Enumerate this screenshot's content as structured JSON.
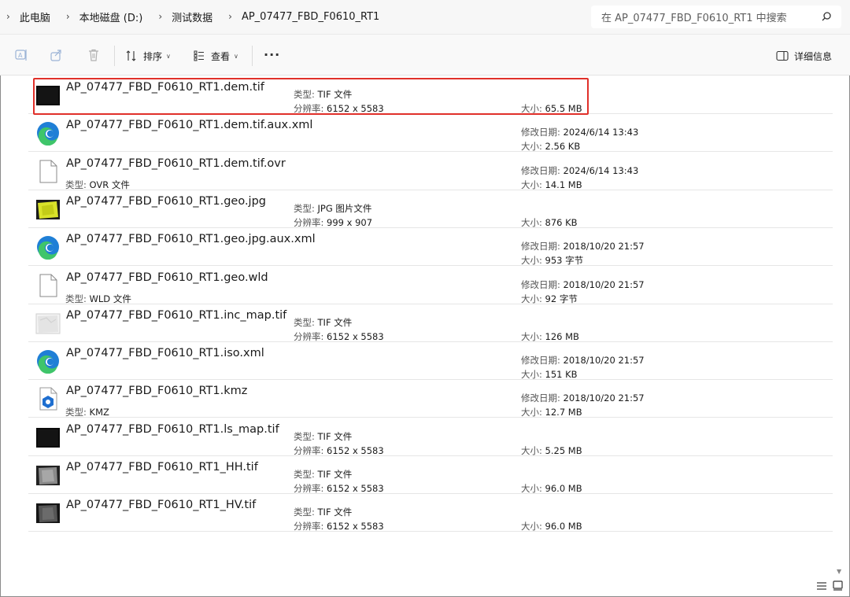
{
  "address": {
    "crumbs": [
      "此电脑",
      "本地磁盘 (D:)",
      "测试数据",
      "AP_07477_FBD_F0610_RT1"
    ],
    "search_placeholder": "在 AP_07477_FBD_F0610_RT1 中搜索"
  },
  "toolbar": {
    "sort_label": "排序",
    "view_label": "查看",
    "more_label": "···",
    "details_label": "详细信息"
  },
  "labels": {
    "type": "类型:",
    "resolution": "分辨率:",
    "size": "大小:",
    "modified": "修改日期:"
  },
  "files": [
    {
      "name": "AP_07477_FBD_F0610_RT1.dem.tif",
      "icon": "dark-image-thumbnail",
      "type": "TIF 文件",
      "resolution": "6152 x 5583",
      "size": "65.5 MB",
      "highlighted": true
    },
    {
      "name": "AP_07477_FBD_F0610_RT1.dem.tif.aux.xml",
      "icon": "edge-icon",
      "modified": "2024/6/14 13:43",
      "size": "2.56 KB"
    },
    {
      "name": "AP_07477_FBD_F0610_RT1.dem.tif.ovr",
      "icon": "blank-file-icon",
      "type": "OVR 文件",
      "modified": "2024/6/14 13:43",
      "size": "14.1 MB"
    },
    {
      "name": "AP_07477_FBD_F0610_RT1.geo.jpg",
      "icon": "yellow-image-thumbnail",
      "type": "JPG 图片文件",
      "resolution": "999 x 907",
      "size": "876 KB"
    },
    {
      "name": "AP_07477_FBD_F0610_RT1.geo.jpg.aux.xml",
      "icon": "edge-icon",
      "modified": "2018/10/20 21:57",
      "size": "953 字节"
    },
    {
      "name": "AP_07477_FBD_F0610_RT1.geo.wld",
      "icon": "blank-file-icon",
      "type": "WLD 文件",
      "modified": "2018/10/20 21:57",
      "size": "92 字节"
    },
    {
      "name": "AP_07477_FBD_F0610_RT1.inc_map.tif",
      "icon": "light-image-thumbnail",
      "type": "TIF 文件",
      "resolution": "6152 x 5583",
      "size": "126 MB"
    },
    {
      "name": "AP_07477_FBD_F0610_RT1.iso.xml",
      "icon": "edge-icon",
      "modified": "2018/10/20 21:57",
      "size": "151 KB"
    },
    {
      "name": "AP_07477_FBD_F0610_RT1.kmz",
      "icon": "kmz-file-icon",
      "type": "KMZ",
      "modified": "2018/10/20 21:57",
      "size": "12.7 MB"
    },
    {
      "name": "AP_07477_FBD_F0610_RT1.ls_map.tif",
      "icon": "dark-image-thumbnail",
      "type": "TIF 文件",
      "resolution": "6152 x 5583",
      "size": "5.25 MB"
    },
    {
      "name": "AP_07477_FBD_F0610_RT1_HH.tif",
      "icon": "gray-image-thumbnail",
      "type": "TIF 文件",
      "resolution": "6152 x 5583",
      "size": "96.0 MB"
    },
    {
      "name": "AP_07477_FBD_F0610_RT1_HV.tif",
      "icon": "dark-gray-image-thumbnail",
      "type": "TIF 文件",
      "resolution": "6152 x 5583",
      "size": "96.0 MB"
    }
  ],
  "colors": {
    "highlight": "#e0302a",
    "edge_blue": "#1f7fd6",
    "edge_green": "#3fc56a"
  }
}
